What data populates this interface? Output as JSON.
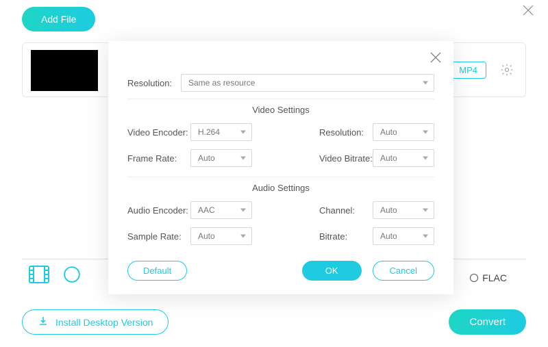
{
  "header": {
    "add_file": "Add File"
  },
  "file_row": {
    "format_badge": "MP4"
  },
  "modal": {
    "resolution_label": "Resolution:",
    "resolution_value": "Same as resource",
    "video_section": "Video Settings",
    "audio_section": "Audio Settings",
    "video": {
      "encoder_label": "Video Encoder:",
      "encoder_value": "H.264",
      "frame_rate_label": "Frame Rate:",
      "frame_rate_value": "Auto",
      "resolution_label": "Resolution:",
      "resolution_value": "Auto",
      "bitrate_label": "Video Bitrate:",
      "bitrate_value": "Auto"
    },
    "audio": {
      "encoder_label": "Audio Encoder:",
      "encoder_value": "AAC",
      "sample_rate_label": "Sample Rate:",
      "sample_rate_value": "Auto",
      "channel_label": "Channel:",
      "channel_value": "Auto",
      "bitrate_label": "Bitrate:",
      "bitrate_value": "Auto"
    },
    "buttons": {
      "default": "Default",
      "ok": "OK",
      "cancel": "Cancel"
    }
  },
  "bottom": {
    "flac_label": "FLAC",
    "install": "Install Desktop Version",
    "convert": "Convert"
  }
}
